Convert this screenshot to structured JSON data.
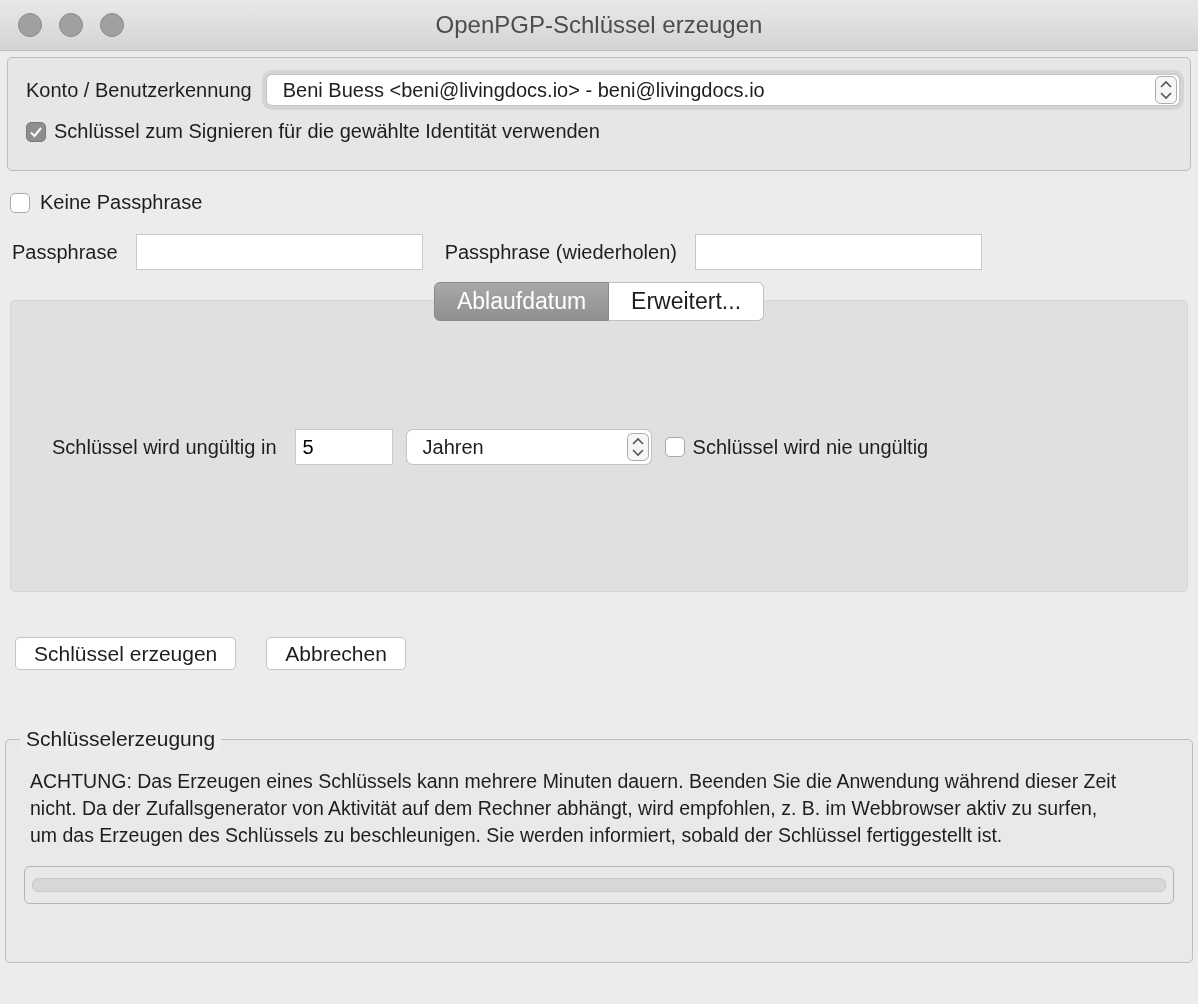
{
  "window": {
    "title": "OpenPGP-Schlüssel erzeugen"
  },
  "identity": {
    "label": "Konto / Benutzerkennung",
    "value": "Beni Buess <beni@livingdocs.io> - beni@livingdocs.io",
    "sign_checkbox": {
      "label": "Schlüssel zum Signieren für die gewählte Identität verwenden",
      "checked": true
    }
  },
  "no_passphrase": {
    "label": "Keine Passphrase",
    "checked": false
  },
  "passphrase": {
    "label": "Passphrase"
  },
  "passphrase_repeat": {
    "label": "Passphrase (wiederholen)"
  },
  "tabs": [
    {
      "label": "Ablaufdatum",
      "selected": true
    },
    {
      "label": "Erweitert...",
      "selected": false
    }
  ],
  "expiry": {
    "label": "Schlüssel wird ungültig in",
    "amount": "5",
    "unit": "Jahren",
    "never": {
      "label": "Schlüssel wird nie ungültig",
      "checked": false
    }
  },
  "buttons": [
    "Schlüssel erzeugen",
    "Abbrechen"
  ],
  "generation": {
    "title": "Schlüsselerzeugung",
    "message": "ACHTUNG: Das Erzeugen eines Schlüssels kann mehrere Minuten dauern. Beenden Sie die Anwendung während dieser Zeit nicht. Da der Zufallsgenerator von Aktivität auf dem Rechner abhängt, wird empfohlen, z. B. im Webbrowser aktiv zu surfen, um das Erzeugen des Schlüssels zu beschleunigen. Sie werden informiert, sobald der Schlüssel fertiggestellt ist.",
    "progress": {
      "level": 0
    }
  }
}
